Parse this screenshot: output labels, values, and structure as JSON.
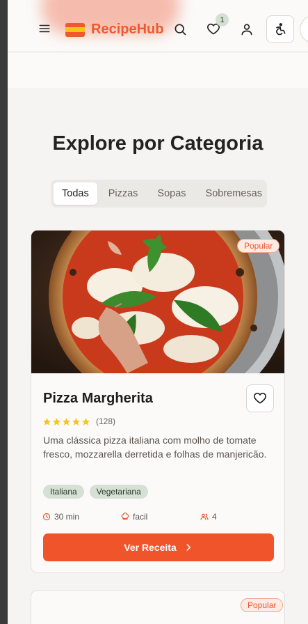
{
  "header": {
    "brand": "RecipeHub",
    "favorites_count": "1",
    "logo_colors": [
      "#ee5a2d",
      "#f5c518",
      "#ee5a2d"
    ]
  },
  "section": {
    "title": "Explore por Categoria"
  },
  "tabs": [
    {
      "label": "Todas",
      "active": true
    },
    {
      "label": "Pizzas",
      "active": false
    },
    {
      "label": "Sopas",
      "active": false
    },
    {
      "label": "Sobremesas",
      "active": false
    }
  ],
  "recipe": {
    "badge": "Popular",
    "title": "Pizza Margherita",
    "rating": 5,
    "rating_count": "(128)",
    "description": "Uma clássica pizza italiana com molho de tomate fresco, mozzarella derretida e folhas de manjericão.",
    "tags": [
      "Italiana",
      "Vegetariana"
    ],
    "time": "30 min",
    "difficulty": "facil",
    "servings": "4",
    "cta": "Ver Receita"
  },
  "next_recipe": {
    "badge": "Popular"
  },
  "colors": {
    "accent": "#f0542a",
    "brand": "#ee5a2d",
    "tag_bg": "#d6e1d5",
    "star": "#f5c518"
  },
  "icons": [
    "menu-icon",
    "search-icon",
    "heart-icon",
    "user-icon",
    "accessibility-icon",
    "clock-icon",
    "chef-hat-icon",
    "users-icon",
    "chevron-right-icon",
    "star-icon"
  ]
}
